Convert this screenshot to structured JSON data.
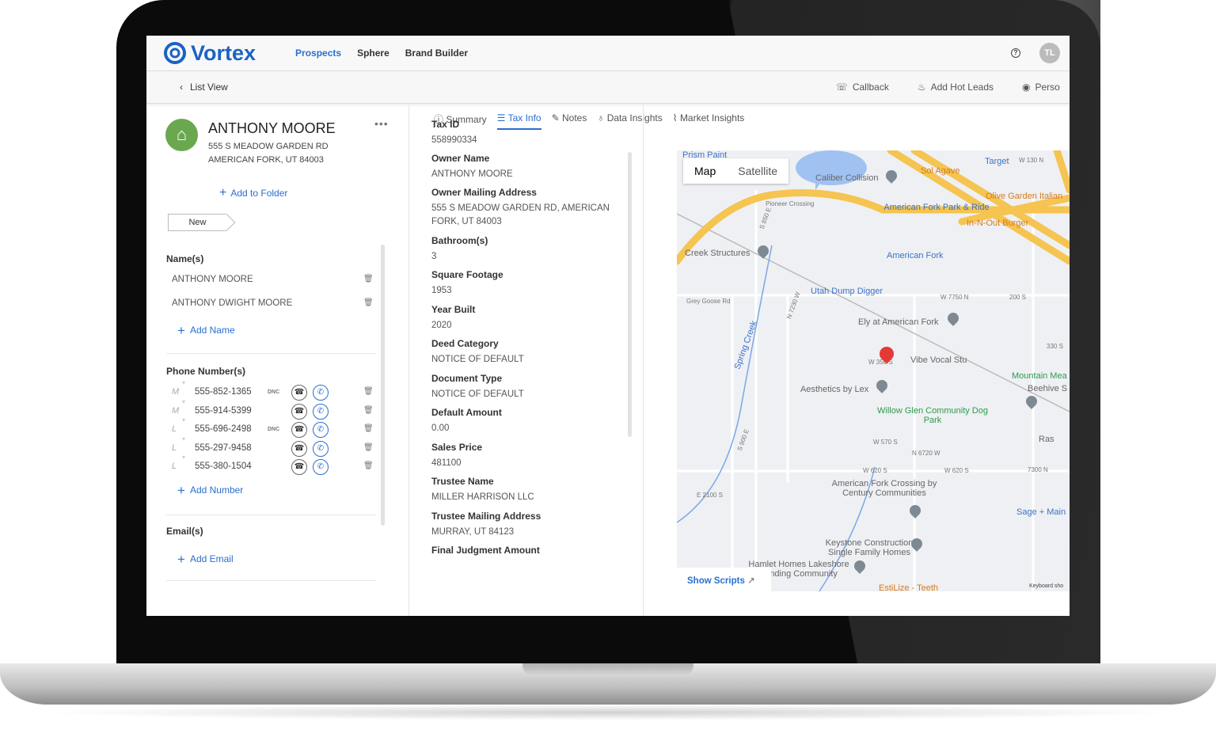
{
  "header": {
    "brand": "Vortex",
    "nav": [
      "Prospects",
      "Sphere",
      "Brand Builder"
    ],
    "active_nav": "Prospects",
    "help_icon": "?",
    "avatar": "TL"
  },
  "subbar": {
    "back": "List View",
    "actions": [
      "Callback",
      "Add Hot Leads",
      "Perso"
    ]
  },
  "prospect": {
    "name": "ANTHONY MOORE",
    "address1": "555 S MEADOW GARDEN RD",
    "address2": "AMERICAN FORK, UT 84003",
    "add_to_folder": "Add to Folder",
    "status": "New"
  },
  "names": {
    "title": "Name(s)",
    "items": [
      "ANTHONY MOORE",
      "ANTHONY DWIGHT MOORE"
    ],
    "add": "Add Name"
  },
  "phones": {
    "title": "Phone Number(s)",
    "items": [
      {
        "type": "M",
        "number": "555-852-1365",
        "dnc": "DNC"
      },
      {
        "type": "M",
        "number": "555-914-5399",
        "dnc": ""
      },
      {
        "type": "L",
        "number": "555-696-2498",
        "dnc": "DNC"
      },
      {
        "type": "L",
        "number": "555-297-9458",
        "dnc": ""
      },
      {
        "type": "L",
        "number": "555-380-1504",
        "dnc": ""
      }
    ],
    "add": "Add Number"
  },
  "emails": {
    "title": "Email(s)",
    "add": "Add Email"
  },
  "tabs": [
    "Summary",
    "Tax Info",
    "Notes",
    "Data Insights",
    "Market Insights"
  ],
  "active_tab": "Tax Info",
  "tax_info": [
    {
      "label": "Tax ID",
      "value": "558990334"
    },
    {
      "label": "Owner Name",
      "value": "ANTHONY MOORE"
    },
    {
      "label": "Owner Mailing Address",
      "value": "555 S MEADOW GARDEN RD, AMERICAN FORK, UT 84003"
    },
    {
      "label": "Bathroom(s)",
      "value": "3"
    },
    {
      "label": "Square Footage",
      "value": "1953"
    },
    {
      "label": "Year Built",
      "value": "2020"
    },
    {
      "label": "Deed Category",
      "value": "NOTICE OF DEFAULT"
    },
    {
      "label": "Document Type",
      "value": "NOTICE OF DEFAULT"
    },
    {
      "label": "Default Amount",
      "value": "0.00"
    },
    {
      "label": "Sales Price",
      "value": "481100"
    },
    {
      "label": "Trustee Name",
      "value": "MILLER HARRISON LLC"
    },
    {
      "label": "Trustee Mailing Address",
      "value": "MURRAY, UT 84123"
    },
    {
      "label": "Final Judgment Amount",
      "value": ""
    }
  ],
  "map": {
    "types": [
      "Map",
      "Satellite"
    ],
    "active_type": "Map",
    "show_scripts": "Show Scripts",
    "keyboard": "Keyboard sho",
    "labels": [
      "Prism Paint",
      "Caliber Collision",
      "Sol Agave",
      "Target",
      "W 130 N",
      "Olive Garden Italian",
      "Pioneer Crossing",
      "American Fork Park & Ride",
      "In-N-Out Burger",
      "Creek Structures",
      "American Fork",
      "Utah Dump Digger",
      "W 7750 N",
      "200 S",
      "Grey Goose Rd",
      "Ely at American Fork",
      "330 S",
      "W 350 S",
      "Vibe Vocal Stu",
      "Aesthetics by Lex",
      "Mountain Mea",
      "Beehive S",
      "Willow Glen Community Dog Park",
      "W 570 S",
      "N 6720 W",
      "Ras",
      "W 620 S",
      "W 620 S",
      "7300 N",
      "American Fork Crossing by Century Communities",
      "E 2100 S",
      "Sage + Main",
      "Keystone Construction Single Family Homes",
      "Hamlet Homes Lakeshore Landing Community",
      "EstiLize - Teeth",
      "S 850 E",
      "Spring Creek",
      "S 900 E",
      "N 7230 W"
    ],
    "colors": {
      "highway": "#f5c451",
      "water": "#9fc2f2",
      "marker": "#e53935"
    }
  }
}
